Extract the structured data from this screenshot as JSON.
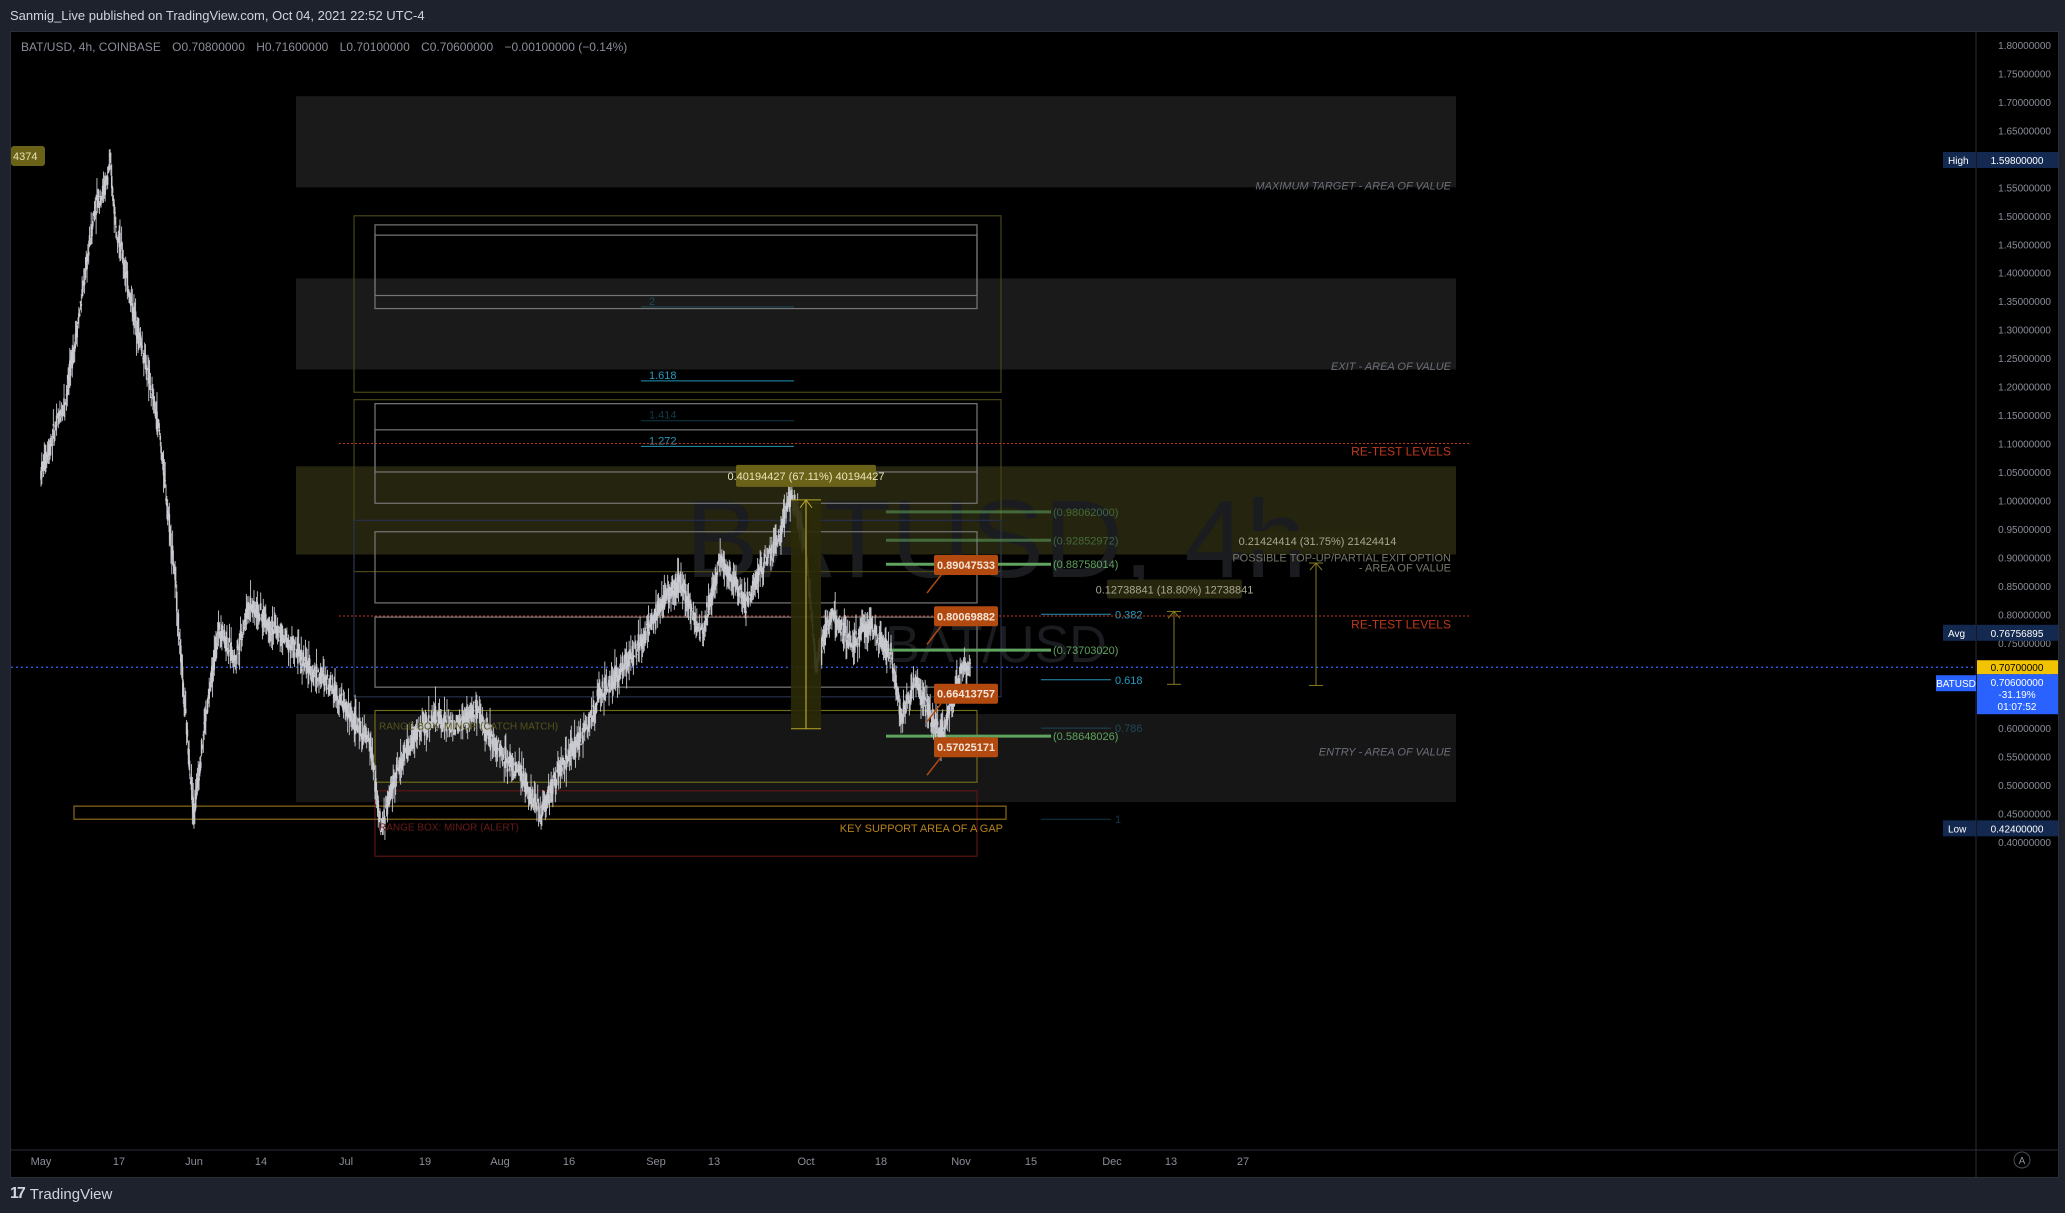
{
  "publisher_line": "Sanmig_Live published on TradingView.com, Oct 04, 2021 22:52 UTC-4",
  "brand": {
    "logo_mark": "17",
    "name": "TradingView"
  },
  "legend": {
    "symbol": "BAT/USD, 4h, COINBASE",
    "open": "O0.70800000",
    "high": "H0.71600000",
    "low": "L0.70100000",
    "close": "C0.70600000",
    "change": "−0.00100000 (−0.14%)"
  },
  "watermark": {
    "main": "BATUSD, 4h",
    "sub": "BAT/USD"
  },
  "price_tag_left": "4374",
  "colors": {
    "background": "#000000",
    "candle": "#c9cbd1",
    "fib_cyan": "#2aa3c9",
    "green_level": "#5fa35f",
    "retest_red": "#c0391b",
    "orange_label": "#b24a10",
    "yellow": "#a69a2a",
    "blue_line": "#2962ff",
    "current_price": "#f2c300"
  },
  "chart_data": {
    "type": "candlestick",
    "title": "BATUSD, 4h",
    "ylim": [
      0.38,
      1.81
    ],
    "x_ticks": [
      "May",
      "17",
      "Jun",
      "14",
      "Jul",
      "19",
      "Aug",
      "16",
      "Sep",
      "13",
      "Oct",
      "18",
      "Nov",
      "15",
      "Dec",
      "13",
      "27"
    ],
    "y_ticks": [
      "1.80000000",
      "1.75000000",
      "1.70000000",
      "1.65000000",
      "1.60000000",
      "1.55000000",
      "1.50000000",
      "1.45000000",
      "1.40000000",
      "1.35000000",
      "1.30000000",
      "1.25000000",
      "1.20000000",
      "1.15000000",
      "1.10000000",
      "1.05000000",
      "1.00000000",
      "0.95000000",
      "0.90000000",
      "0.85000000",
      "0.80000000",
      "0.75000000",
      "0.70000000",
      "0.65000000",
      "0.60000000",
      "0.55000000",
      "0.50000000",
      "0.45000000",
      "0.40000000"
    ],
    "price_path": [
      [
        "May 1",
        1.05
      ],
      [
        "May 6",
        1.18
      ],
      [
        "May 9",
        1.34
      ],
      [
        "May 12",
        1.52
      ],
      [
        "May 14",
        1.55
      ],
      [
        "May 15",
        1.59
      ],
      [
        "May 16",
        1.5
      ],
      [
        "May 19",
        1.36
      ],
      [
        "May 22",
        1.25
      ],
      [
        "May 25",
        1.12
      ],
      [
        "May 28",
        0.88
      ],
      [
        "May 30",
        0.65
      ],
      [
        "Jun 1",
        0.45
      ],
      [
        "Jun 3",
        0.6
      ],
      [
        "Jun 6",
        0.78
      ],
      [
        "Jun 9",
        0.72
      ],
      [
        "Jun 12",
        0.82
      ],
      [
        "Jun 16",
        0.78
      ],
      [
        "Jun 20",
        0.75
      ],
      [
        "Jun 24",
        0.7
      ],
      [
        "Jun 28",
        0.68
      ],
      [
        "Jul 2",
        0.62
      ],
      [
        "Jul 6",
        0.57
      ],
      [
        "Jul 8",
        0.42
      ],
      [
        "Jul 11",
        0.52
      ],
      [
        "Jul 15",
        0.59
      ],
      [
        "Jul 19",
        0.62
      ],
      [
        "Jul 23",
        0.6
      ],
      [
        "Jul 27",
        0.63
      ],
      [
        "Aug 1",
        0.56
      ],
      [
        "Aug 5",
        0.52
      ],
      [
        "Aug 9",
        0.45
      ],
      [
        "Aug 13",
        0.53
      ],
      [
        "Aug 17",
        0.58
      ],
      [
        "Aug 21",
        0.66
      ],
      [
        "Aug 25",
        0.7
      ],
      [
        "Aug 29",
        0.75
      ],
      [
        "Sep 2",
        0.82
      ],
      [
        "Sep 6",
        0.86
      ],
      [
        "Sep 10",
        0.76
      ],
      [
        "Sep 14",
        0.9
      ],
      [
        "Sep 16",
        0.87
      ],
      [
        "Sep 19",
        0.82
      ],
      [
        "Sep 22",
        0.88
      ],
      [
        "Sep 25",
        0.92
      ],
      [
        "Sep 28",
        1.01
      ],
      [
        "Oct 1",
        0.92
      ],
      [
        "Oct 3",
        0.71
      ],
      [
        "Oct 6",
        0.8
      ],
      [
        "Oct 10",
        0.75
      ],
      [
        "Oct 14",
        0.78
      ],
      [
        "Oct 18",
        0.73
      ],
      [
        "Oct 20",
        0.62
      ],
      [
        "Oct 23",
        0.68
      ],
      [
        "Oct 26",
        0.62
      ],
      [
        "Oct 28",
        0.59
      ],
      [
        "Oct 30",
        0.64
      ],
      [
        "Nov 1",
        0.7
      ],
      [
        "Nov 3",
        0.71
      ]
    ],
    "fib_levels_cyan": [
      {
        "label": "2",
        "value": 1.34
      },
      {
        "label": "1.618",
        "value": 1.21
      },
      {
        "label": "1.414",
        "value": 1.14
      },
      {
        "label": "1.272",
        "value": 1.095
      },
      {
        "label": "0.382",
        "value": 0.8
      },
      {
        "label": "0.618",
        "value": 0.685
      },
      {
        "label": "0.786",
        "value": 0.6
      },
      {
        "label": "1",
        "value": 0.44
      }
    ],
    "green_levels": [
      {
        "label": "(0.98062000)",
        "value": 0.98
      },
      {
        "label": "(0.92852972)",
        "value": 0.93
      },
      {
        "label": "(0.88758014)",
        "value": 0.888
      },
      {
        "label": "(0.73703020)",
        "value": 0.737
      },
      {
        "label": "(0.58648026)",
        "value": 0.586
      }
    ],
    "orange_labels": [
      {
        "label": "0.89047533",
        "value": 0.89
      },
      {
        "label": "0.80069882",
        "value": 0.8
      },
      {
        "label": "0.66413757",
        "value": 0.664
      },
      {
        "label": "0.57025171",
        "value": 0.57
      }
    ],
    "measure_boxes": [
      {
        "label": "0.40194427 (67.11%) 40194427",
        "from": 0.599,
        "to": 1.001
      },
      {
        "label": "0.12738841 (18.80%) 12738841",
        "from": 0.677,
        "to": 0.805
      },
      {
        "label": "0.21424414 (31.75%) 21424414",
        "from": 0.675,
        "to": 0.89
      }
    ],
    "zone_labels": {
      "max_target": "MAXIMUM TARGET - AREA OF VALUE",
      "exit": "EXIT - AREA OF VALUE",
      "entry": "ENTRY - AREA OF VALUE",
      "possible_topup_1": "POSSIBLE TOP-UP/PARTIAL EXIT OPTION",
      "possible_topup_2": "- AREA OF VALUE",
      "retest": "RE-TEST LEVELS",
      "key_support": "KEY SUPPORT AREA OF A GAP",
      "range_minor_catch": "RANGE BOX: MINOR  (CATCH MATCH)",
      "range_minor_alert": "RANGE BOX: MINOR (ALERT)"
    },
    "price_tags": {
      "high_label": "High",
      "high_value": "1.59800000",
      "avg_label": "Avg",
      "avg_value": "0.76756895",
      "current_value": "0.70700000",
      "symbol_label": "BATUSD",
      "last_value": "0.70600000",
      "change_pct": "-31.19%",
      "countdown": "01:07:52",
      "low_label": "Low",
      "low_value": "0.42400000"
    },
    "current_price": 0.707
  },
  "scale_button": "A"
}
